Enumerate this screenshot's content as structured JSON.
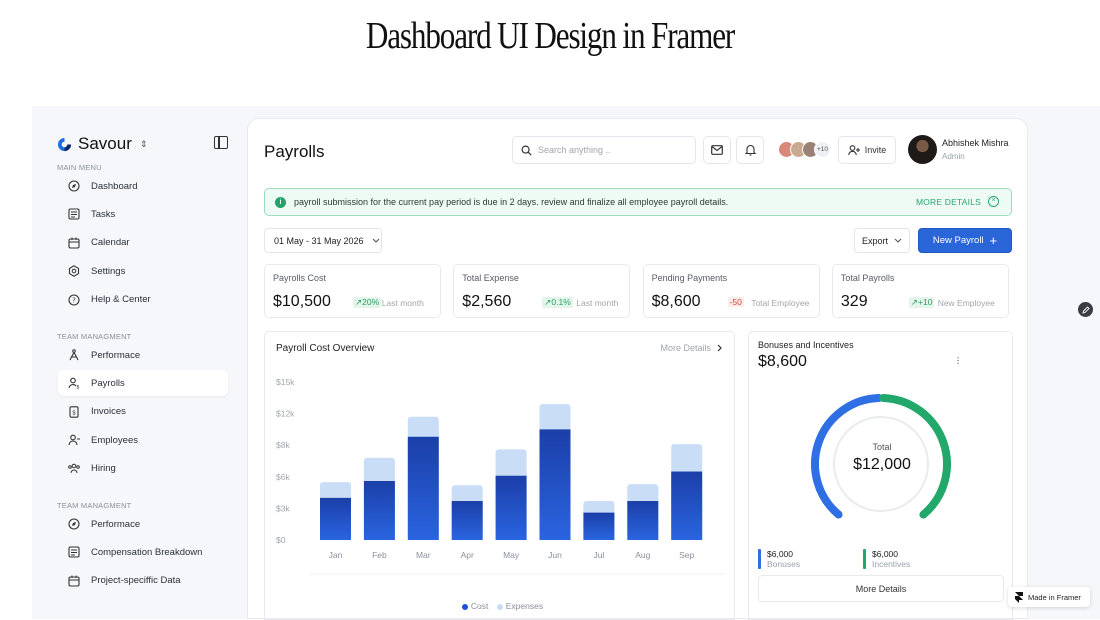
{
  "headline": "Dashboard UI Design in Framer",
  "brand": {
    "name": "Savour"
  },
  "sidebar": {
    "main_menu_label": "MAIN MENU",
    "main_items": [
      {
        "label": "Dashboard",
        "icon": "compass-icon"
      },
      {
        "label": "Tasks",
        "icon": "tasks-icon"
      },
      {
        "label": "Calendar",
        "icon": "calendar-icon"
      },
      {
        "label": "Settings",
        "icon": "gear-icon"
      },
      {
        "label": "Help & Center",
        "icon": "help-icon"
      }
    ],
    "team_label_1": "TEAM MANAGMENT",
    "team_items_1": [
      {
        "label": "Performace",
        "icon": "performance-icon"
      },
      {
        "label": "Payrolls",
        "icon": "payroll-user-icon",
        "active": true
      },
      {
        "label": "Invoices",
        "icon": "invoice-icon"
      },
      {
        "label": "Employees",
        "icon": "user-add-icon"
      },
      {
        "label": "Hiring",
        "icon": "team-icon"
      }
    ],
    "team_label_2": "TEAM MANAGMENT",
    "team_items_2": [
      {
        "label": "Performace",
        "icon": "compass-icon"
      },
      {
        "label": "Compensation Breakdown",
        "icon": "tasks-icon"
      },
      {
        "label": "Project-speciffic Data",
        "icon": "calendar-icon"
      }
    ]
  },
  "header": {
    "title": "Payrolls",
    "search_placeholder": "Search anything ..",
    "avatars_more": "+10",
    "invite_label": "Invite",
    "user_name": "Abhishek Mishra",
    "user_role": "Admin"
  },
  "alert": {
    "message": "payroll submission for the current pay period is due in 2 days. review and finalize all employee payroll details.",
    "link": "MORE DETAILS"
  },
  "toolbar": {
    "date_range": "01 May - 31 May 2026",
    "export_label": "Export",
    "new_payroll_label": "New Payroll"
  },
  "stats": [
    {
      "label": "Payrolls Cost",
      "value": "$10,500",
      "delta": "↗20%",
      "trend": "up",
      "note": "Last month"
    },
    {
      "label": "Total Expense",
      "value": "$2,560",
      "delta": "↗0.1%",
      "trend": "up",
      "note": "Last month"
    },
    {
      "label": "Pending Payments",
      "value": "$8,600",
      "delta": "-50",
      "trend": "down",
      "note": "Total Employee"
    },
    {
      "label": "Total Payrolls",
      "value": "329",
      "delta": "↗+10",
      "trend": "up",
      "note": "New Employee"
    }
  ],
  "overview": {
    "title": "Payroll Cost Overview",
    "more_label": "More Details"
  },
  "bonuses": {
    "title": "Bonuses and Incentives",
    "value": "$8,600",
    "center_label": "Total",
    "center_value": "$12,000",
    "bonuses_amount": "$6,000",
    "bonuses_label": "Bonuses",
    "incentives_amount": "$6,000",
    "incentives_label": "Incentives",
    "more_label": "More Details",
    "colors": {
      "bonuses": "#2f6fe4",
      "incentives": "#22a86b"
    }
  },
  "chart_data": [
    {
      "type": "bar",
      "categories": [
        "Jan",
        "Feb",
        "Mar",
        "Apr",
        "May",
        "Jun",
        "Jul",
        "Aug",
        "Sep"
      ],
      "series": [
        {
          "name": "Cost",
          "values": [
            4000,
            5600,
            9800,
            3700,
            6100,
            10500,
            2600,
            3700,
            6500
          ],
          "color": "#1f4fcf"
        },
        {
          "name": "Expenses",
          "values": [
            1500,
            2200,
            1900,
            1500,
            2500,
            2400,
            1100,
            1600,
            2600
          ],
          "color": "#c9ddf7"
        }
      ],
      "stacked": true,
      "y_ticks": [
        "$0",
        "$3k",
        "$6k",
        "$8k",
        "$12k",
        "$15k"
      ],
      "ylim": [
        0,
        15000
      ],
      "legend": "bottom-center",
      "grid": false
    },
    {
      "type": "pie",
      "style": "donut-arc",
      "categories": [
        "Bonuses",
        "Incentives"
      ],
      "values": [
        6000,
        6000
      ]
    }
  ],
  "footer": {
    "made_in": "Made in Framer"
  }
}
